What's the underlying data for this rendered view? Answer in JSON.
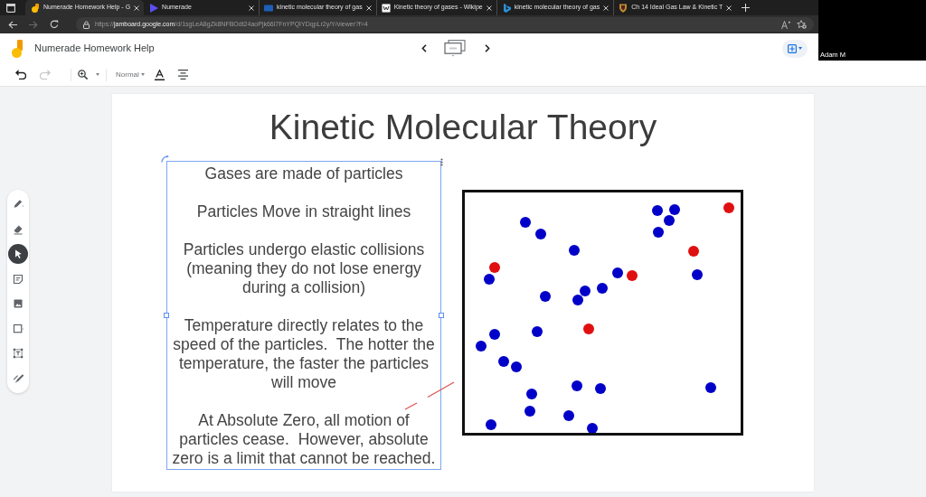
{
  "browser": {
    "tabs": [
      {
        "kind": "board",
        "title": "Numerade Homework Help - G",
        "selected": true
      },
      {
        "kind": "player",
        "title": "Numerade",
        "selected": false
      },
      {
        "kind": "page",
        "title": "kinetic molecular theory of gas",
        "selected": false
      },
      {
        "kind": "wiki",
        "title": "Kinetic theory of gases - Wikipe",
        "selected": false
      },
      {
        "kind": "search",
        "title": "kinetic molecular theory of gas",
        "selected": false
      },
      {
        "kind": "school",
        "title": "Ch 14 Ideal Gas Law & Kinetic T",
        "selected": false
      }
    ],
    "url": "https://**jamboard.google.com**/d/1sgLeA8gZk8NFBOdt24aoPjk66l7FnYPQIYDqpLr2y/Y/viewer?f=4"
  },
  "video": {
    "participant": "Adam M"
  },
  "header": {
    "title": "Numerade Homework Help"
  },
  "toolbar": {
    "actions": [
      {
        "kind": "undo",
        "disabled": false
      },
      {
        "kind": "redo",
        "disabled": true
      }
    ],
    "style": "Normal"
  },
  "tools": [
    {
      "kind": "pen",
      "selected": false
    },
    {
      "kind": "eraser",
      "selected": false
    },
    {
      "kind": "select",
      "selected": true
    },
    {
      "kind": "note",
      "selected": false
    },
    {
      "kind": "image",
      "selected": false
    },
    {
      "kind": "shape",
      "selected": false
    },
    {
      "kind": "textbox",
      "selected": false
    },
    {
      "kind": "laser",
      "selected": false
    }
  ],
  "slide": {
    "title": "Kinetic Molecular Theory",
    "text_box": {
      "selected": true,
      "paragraphs": [
        "Gases are made of particles",
        "Particles Move in straight lines",
        "Particles undergo elastic collisions (meaning they do not lose energy during a collision)",
        "Temperature directly relates to the speed of the particles.  The hotter the temperature, the faster the particles will move",
        "At Absolute Zero, all motion of particles cease.  However, absolute zero is a limit that cannot be reached."
      ]
    },
    "particles": [
      {
        "color": "#e01010"
      },
      {
        "color": "#0000c8"
      },
      {
        "color": "#0000c8"
      },
      {
        "color": "#0000c8"
      },
      {
        "color": "#0000c8"
      },
      {
        "color": "#0000c8"
      },
      {
        "color": "#0000c8"
      },
      {
        "color": "#0000c8"
      },
      {
        "color": "#e01010"
      },
      {
        "color": "#e01010"
      },
      {
        "color": "#0000c8"
      },
      {
        "color": "#0000c8"
      },
      {
        "color": "#e01010"
      },
      {
        "color": "#0000c8"
      },
      {
        "color": "#0000c8"
      },
      {
        "color": "#0000c8"
      },
      {
        "color": "#0000c8"
      },
      {
        "color": "#0000c8"
      },
      {
        "color": "#e01010"
      },
      {
        "color": "#0000c8"
      },
      {
        "color": "#0000c8"
      },
      {
        "color": "#0000c8"
      },
      {
        "color": "#0000c8"
      },
      {
        "color": "#0000c8"
      },
      {
        "color": "#0000c8"
      },
      {
        "color": "#0000c8"
      },
      {
        "color": "#0000c8"
      },
      {
        "color": "#0000c8"
      },
      {
        "color": "#0000c8"
      },
      {
        "color": "#0000c8"
      },
      {
        "color": "#0000c8"
      },
      {
        "color": "#0000c8"
      }
    ]
  }
}
